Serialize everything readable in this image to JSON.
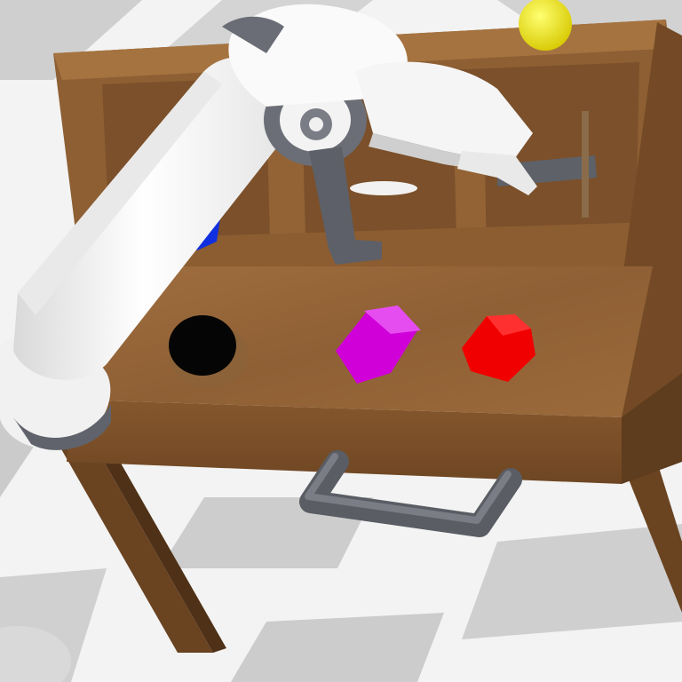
{
  "scene": {
    "colors": {
      "floor_light": "#f4f4f4",
      "floor_dark": "#c9c9c9",
      "wood_top": "#9a6a3c",
      "wood_side": "#7d522b",
      "wood_dark": "#5e3c1e",
      "robot_white": "#f7f7f7",
      "robot_shade": "#d6d6d6",
      "robot_gray": "#6d7078",
      "handle_gray": "#5c5f66",
      "yellow_ball": "#f2e600",
      "blue_object": "#1030e0",
      "black_hole": "#050505",
      "magenta_block": "#d000d8",
      "red_block": "#f00000"
    },
    "objects": [
      {
        "name": "yellow-ball",
        "color": "yellow"
      },
      {
        "name": "blue-object",
        "color": "blue"
      },
      {
        "name": "magenta-block",
        "color": "magenta"
      },
      {
        "name": "red-block",
        "color": "red"
      },
      {
        "name": "black-hole",
        "color": "black"
      },
      {
        "name": "drawer-handle",
        "color": "gray"
      },
      {
        "name": "robot-arm",
        "color": "white"
      }
    ]
  }
}
